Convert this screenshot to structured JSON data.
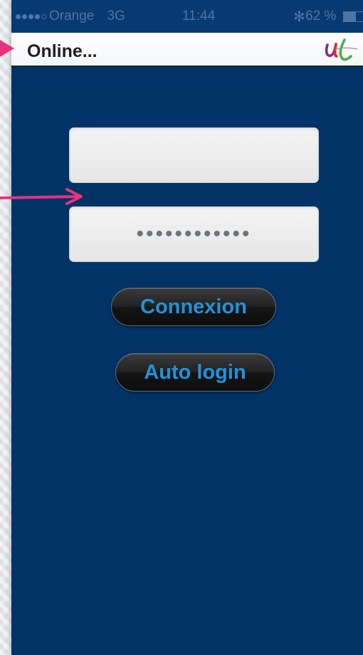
{
  "status_bar": {
    "carrier": "Orange",
    "network": "3G",
    "time": "11:44",
    "battery": "62 %",
    "icons": [
      "signal-dots-icon",
      "bluetooth-icon",
      "battery-icon"
    ]
  },
  "nav": {
    "title": "Online...",
    "logo_icon": "ul-logo"
  },
  "login": {
    "username_value": "",
    "password_value": "••••••••••••"
  },
  "buttons": {
    "connexion": "Connexion",
    "auto_login": "Auto login"
  },
  "colors": {
    "background": "#023367",
    "button_text": "#1f93dc",
    "annotation_arrow": "#e8327f"
  }
}
